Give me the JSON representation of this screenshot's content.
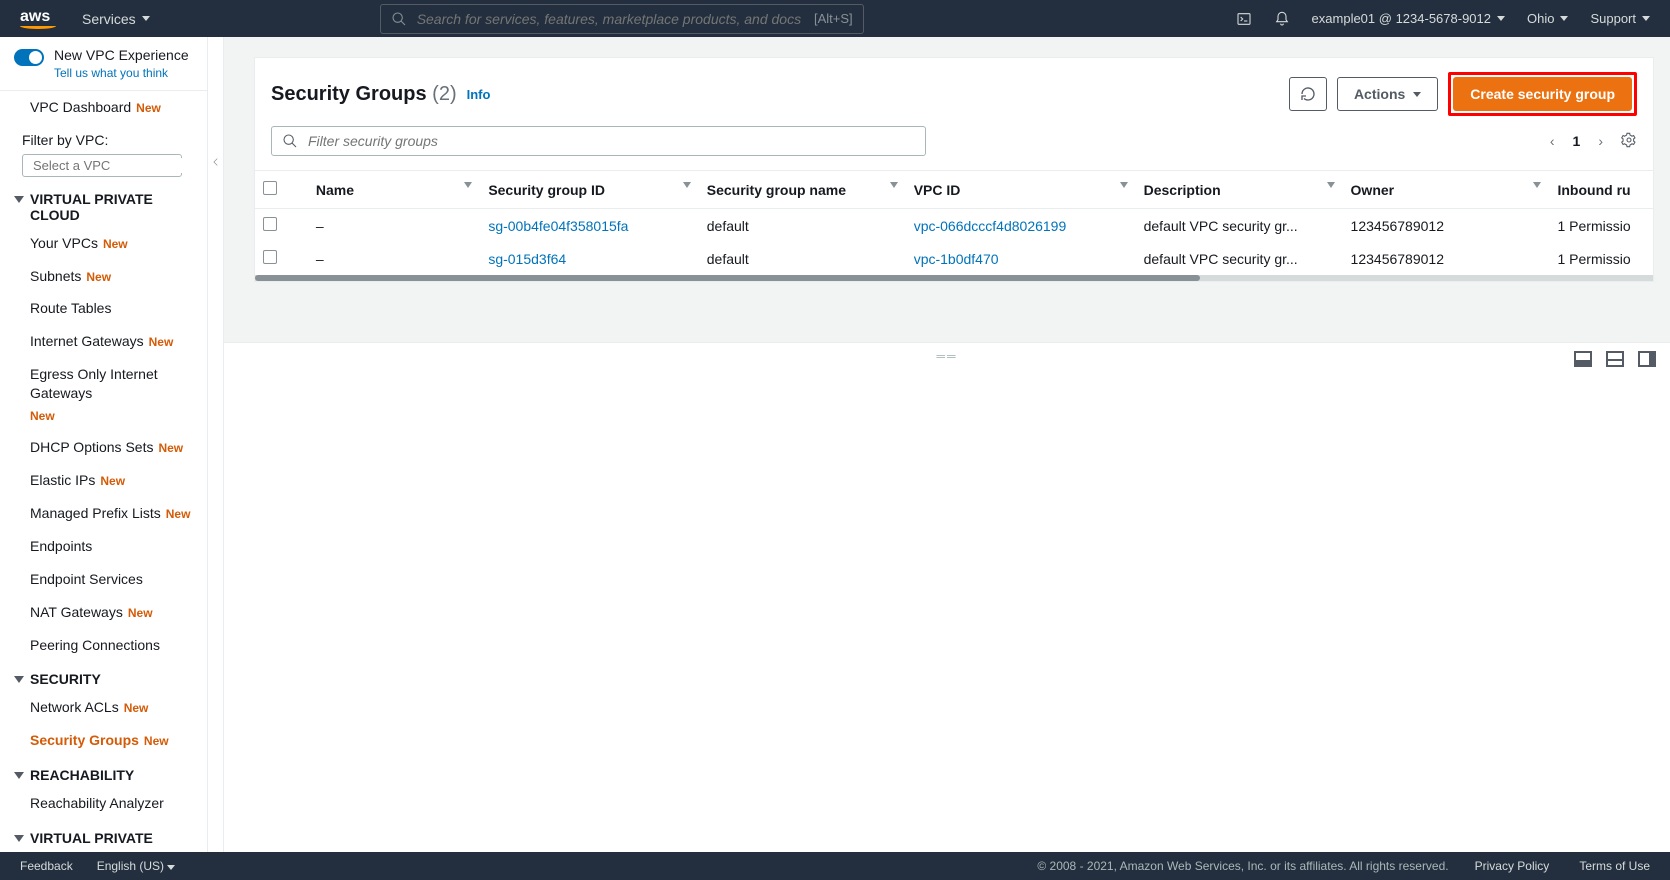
{
  "topnav": {
    "services": "Services",
    "search_placeholder": "Search for services, features, marketplace products, and docs",
    "search_shortcut": "[Alt+S]",
    "account": "example01 @ 1234-5678-9012",
    "region": "Ohio",
    "support": "Support"
  },
  "sidebar": {
    "new_experience": "New VPC Experience",
    "new_experience_sub": "Tell us what you think",
    "dashboard": "VPC Dashboard",
    "filter_label": "Filter by VPC:",
    "filter_placeholder": "Select a VPC",
    "sections": {
      "vpc": "VIRTUAL PRIVATE CLOUD",
      "security": "SECURITY",
      "reachability": "REACHABILITY",
      "vpn": "VIRTUAL PRIVATE"
    },
    "items": {
      "your_vpcs": "Your VPCs",
      "subnets": "Subnets",
      "route_tables": "Route Tables",
      "internet_gateways": "Internet Gateways",
      "egress_gateways": "Egress Only Internet Gateways",
      "dhcp": "DHCP Options Sets",
      "elastic_ips": "Elastic IPs",
      "prefix_lists": "Managed Prefix Lists",
      "endpoints": "Endpoints",
      "endpoint_services": "Endpoint Services",
      "nat_gateways": "NAT Gateways",
      "peering": "Peering Connections",
      "network_acls": "Network ACLs",
      "security_groups": "Security Groups",
      "reachability_analyzer": "Reachability Analyzer"
    },
    "new_badge": "New"
  },
  "panel": {
    "title": "Security Groups",
    "count": "(2)",
    "info": "Info",
    "actions": "Actions",
    "create": "Create security group",
    "filter_placeholder": "Filter security groups",
    "page": "1"
  },
  "table": {
    "headers": {
      "name": "Name",
      "sg_id": "Security group ID",
      "sg_name": "Security group name",
      "vpc_id": "VPC ID",
      "description": "Description",
      "owner": "Owner",
      "inbound": "Inbound ru"
    },
    "rows": [
      {
        "name": "–",
        "sg_id": "sg-00b4fe04f358015fa",
        "sg_name": "default",
        "vpc_id": "vpc-066dcccf4d8026199",
        "description": "default VPC security gr...",
        "owner": "123456789012",
        "inbound": "1 Permissio"
      },
      {
        "name": "–",
        "sg_id": "sg-015d3f64",
        "sg_name": "default",
        "vpc_id": "vpc-1b0df470",
        "description": "default VPC security gr...",
        "owner": "123456789012",
        "inbound": "1 Permissio"
      }
    ]
  },
  "footer": {
    "feedback": "Feedback",
    "language": "English (US)",
    "copyright": "© 2008 - 2021, Amazon Web Services, Inc. or its affiliates. All rights reserved.",
    "privacy": "Privacy Policy",
    "terms": "Terms of Use"
  }
}
